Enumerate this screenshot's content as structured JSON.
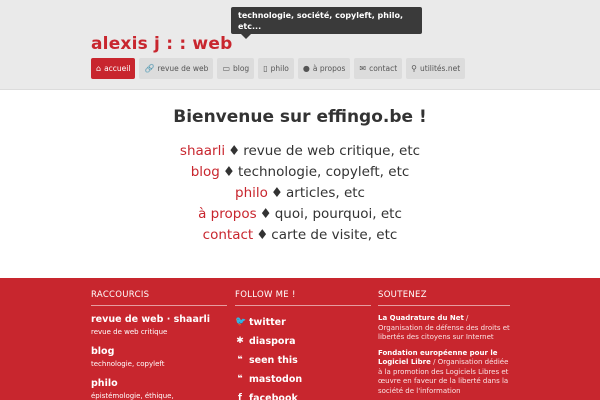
{
  "header": {
    "site_title": "alexis j : : web",
    "tooltip": "technologie, société, copyleft, philo, etc..."
  },
  "nav": {
    "items": [
      {
        "label": "accueil",
        "icon": "home-icon",
        "glyph": "⌂",
        "active": true
      },
      {
        "label": "revue de web",
        "icon": "link-icon",
        "glyph": "🔗",
        "active": false
      },
      {
        "label": "blog",
        "icon": "folder-icon",
        "glyph": "▭",
        "active": false
      },
      {
        "label": "philo",
        "icon": "document-icon",
        "glyph": "▯",
        "active": false
      },
      {
        "label": "à propos",
        "icon": "user-icon",
        "glyph": "●",
        "active": false
      },
      {
        "label": "contact",
        "icon": "envelope-icon",
        "glyph": "✉",
        "active": false
      },
      {
        "label": "utilités.net",
        "icon": "search-icon",
        "glyph": "⚲",
        "active": false
      }
    ]
  },
  "main": {
    "title": "Bienvenue sur effingo.be !",
    "separator": "♦",
    "links": [
      {
        "link": "shaarli",
        "text": "revue de web critique, etc"
      },
      {
        "link": "blog",
        "text": "technologie, copyleft, etc"
      },
      {
        "link": "philo",
        "text": "articles, etc"
      },
      {
        "link": "à propos",
        "text": "quoi, pourquoi, etc"
      },
      {
        "link": "contact",
        "text": "carte de visite, etc"
      }
    ]
  },
  "footer": {
    "raccourcis": {
      "heading": "RACCOURCIS",
      "items": [
        {
          "title": "revue de web · shaarli",
          "sub": "revue de web critique"
        },
        {
          "title": "blog",
          "sub": "technologie, copyleft"
        },
        {
          "title": "philo",
          "sub": "épistémologie, éthique,"
        }
      ]
    },
    "follow": {
      "heading": "FOLLOW ME !",
      "items": [
        {
          "label": "twitter",
          "icon": "twitter-icon",
          "glyph": "🐦"
        },
        {
          "label": "diaspora",
          "icon": "asterisk-icon",
          "glyph": "✱"
        },
        {
          "label": "seen this",
          "icon": "quote-icon",
          "glyph": "❝"
        },
        {
          "label": "mastodon",
          "icon": "quote-icon",
          "glyph": "❝"
        },
        {
          "label": "facebook",
          "icon": "facebook-icon",
          "glyph": "f"
        }
      ]
    },
    "soutenez": {
      "heading": "SOUTENEZ",
      "entries": [
        {
          "name": "La Quadrature du Net",
          "desc": " / Organisation de défense des droits et libertés des citoyens sur Internet"
        },
        {
          "name": "Fondation européenne pour le Logiciel Libre",
          "desc": " / Organisation dédiée à la promotion des Logiciels Libres et œuvre en faveur de la liberté dans la société de l'information"
        }
      ]
    }
  }
}
